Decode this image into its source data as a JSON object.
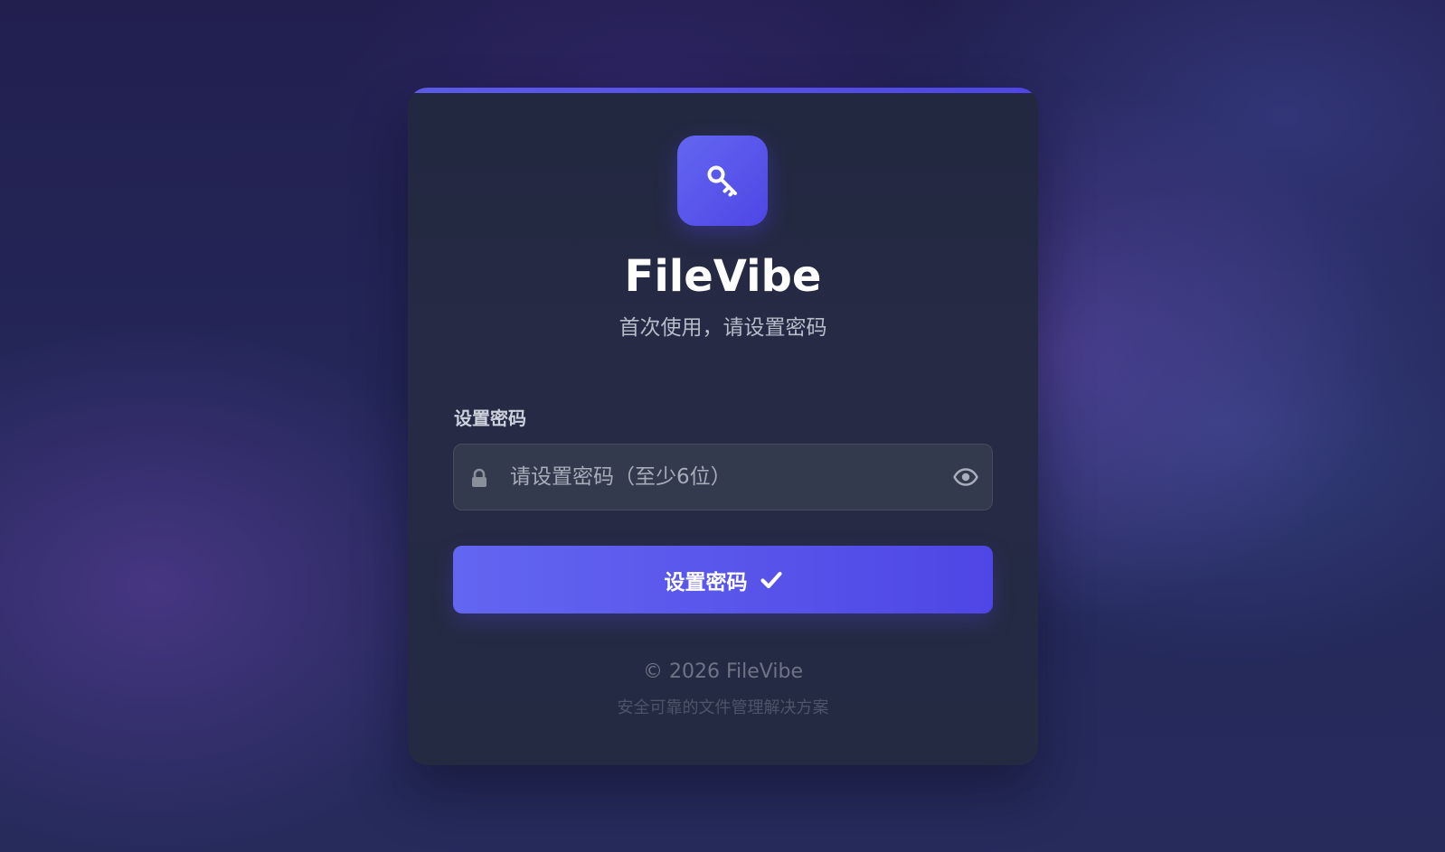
{
  "app": {
    "title": "FileVibe",
    "subtitle": "首次使用，请设置密码",
    "logo_icon": "key-icon"
  },
  "form": {
    "field_label": "设置密码",
    "password": {
      "value": "",
      "placeholder": "请设置密码（至少6位）",
      "leading_icon": "lock-icon",
      "trailing_icon": "eye-icon"
    },
    "submit_label": "设置密码",
    "submit_icon": "check-icon"
  },
  "footer": {
    "copyright": "© 2026 FileVibe",
    "tagline": "安全可靠的文件管理解决方案"
  },
  "colors": {
    "accent": "#4f46e5",
    "accent_light": "#6366f1",
    "card_background": "#252a43",
    "input_background": "#343a4e"
  }
}
